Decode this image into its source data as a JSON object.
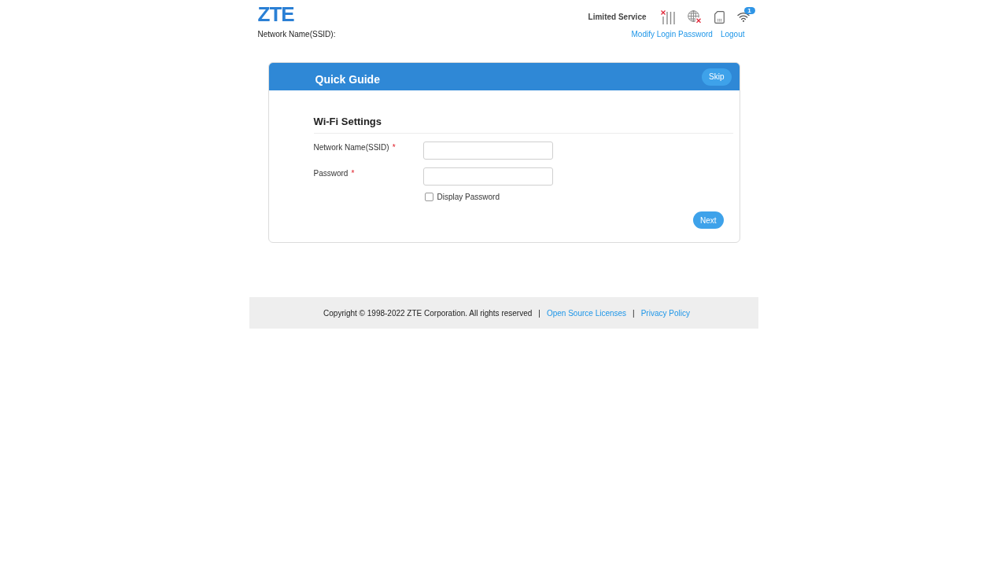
{
  "header": {
    "logo": "ZTE",
    "network_name_label": "Network Name(SSID):",
    "status": "Limited Service",
    "indicators": [
      {
        "kind": "signal",
        "error": true
      },
      {
        "kind": "internet",
        "error": true
      },
      {
        "kind": "sim",
        "error": false
      },
      {
        "kind": "wifi",
        "error": false,
        "badge": "1"
      }
    ],
    "links": [
      "Modify Login Password",
      "Logout"
    ]
  },
  "guide": {
    "title": "Quick Guide",
    "skip_button": "Skip",
    "section_title": "Wi-Fi Settings",
    "fields": [
      {
        "label": "Network Name(SSID)",
        "required_mark": "*"
      },
      {
        "label": "Password",
        "required_mark": "*"
      }
    ],
    "display_password": {
      "label": "Display Password",
      "checked": false
    },
    "next_button": "Next"
  },
  "footer": {
    "items": [
      {
        "kind": "text",
        "text": "Copyright © 1998-2022 ZTE Corporation. All rights reserved"
      },
      {
        "kind": "separator",
        "text": "|"
      },
      {
        "kind": "link",
        "text": "Open Source Licenses"
      },
      {
        "kind": "separator",
        "text": "|"
      },
      {
        "kind": "link",
        "text": "Privacy Policy"
      }
    ]
  }
}
